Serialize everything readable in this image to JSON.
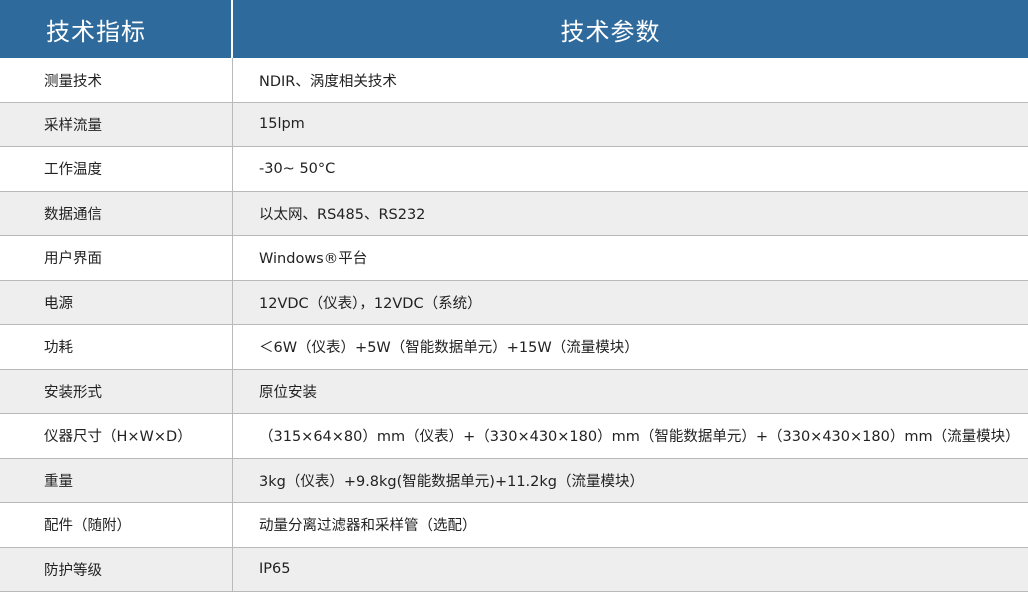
{
  "header": {
    "col1": "技术指标",
    "col2": "技术参数"
  },
  "rows": [
    {
      "label": "测量技术",
      "value": "NDIR、涡度相关技术"
    },
    {
      "label": "采样流量",
      "value": "15lpm"
    },
    {
      "label": "工作温度",
      "value": "-30~ 50°C"
    },
    {
      "label": "数据通信",
      "value": "以太网、RS485、RS232"
    },
    {
      "label": "用户界面",
      "value": "Windows®平台"
    },
    {
      "label": "电源",
      "value": "12VDC（仪表），12VDC（系统）"
    },
    {
      "label": "功耗",
      "value": "＜6W（仪表）+5W（智能数据单元）+15W（流量模块）"
    },
    {
      "label": "安装形式",
      "value": "原位安装"
    },
    {
      "label": "仪器尺寸（H×W×D）",
      "value": "（315×64×80）mm（仪表）+（330×430×180）mm（智能数据单元）+（330×430×180）mm（流量模块）"
    },
    {
      "label": "重量",
      "value": "3kg（仪表）+9.8kg(智能数据单元)+11.2kg（流量模块）"
    },
    {
      "label": "配件（随附）",
      "value": "动量分离过滤器和采样管（选配）"
    },
    {
      "label": "防护等级",
      "value": "IP65"
    }
  ],
  "colors": {
    "header_bg": "#2f6a9c",
    "header_text": "#ffffff",
    "row_alt_bg": "#eeeeee",
    "grid_line": "#b9b9b9"
  }
}
